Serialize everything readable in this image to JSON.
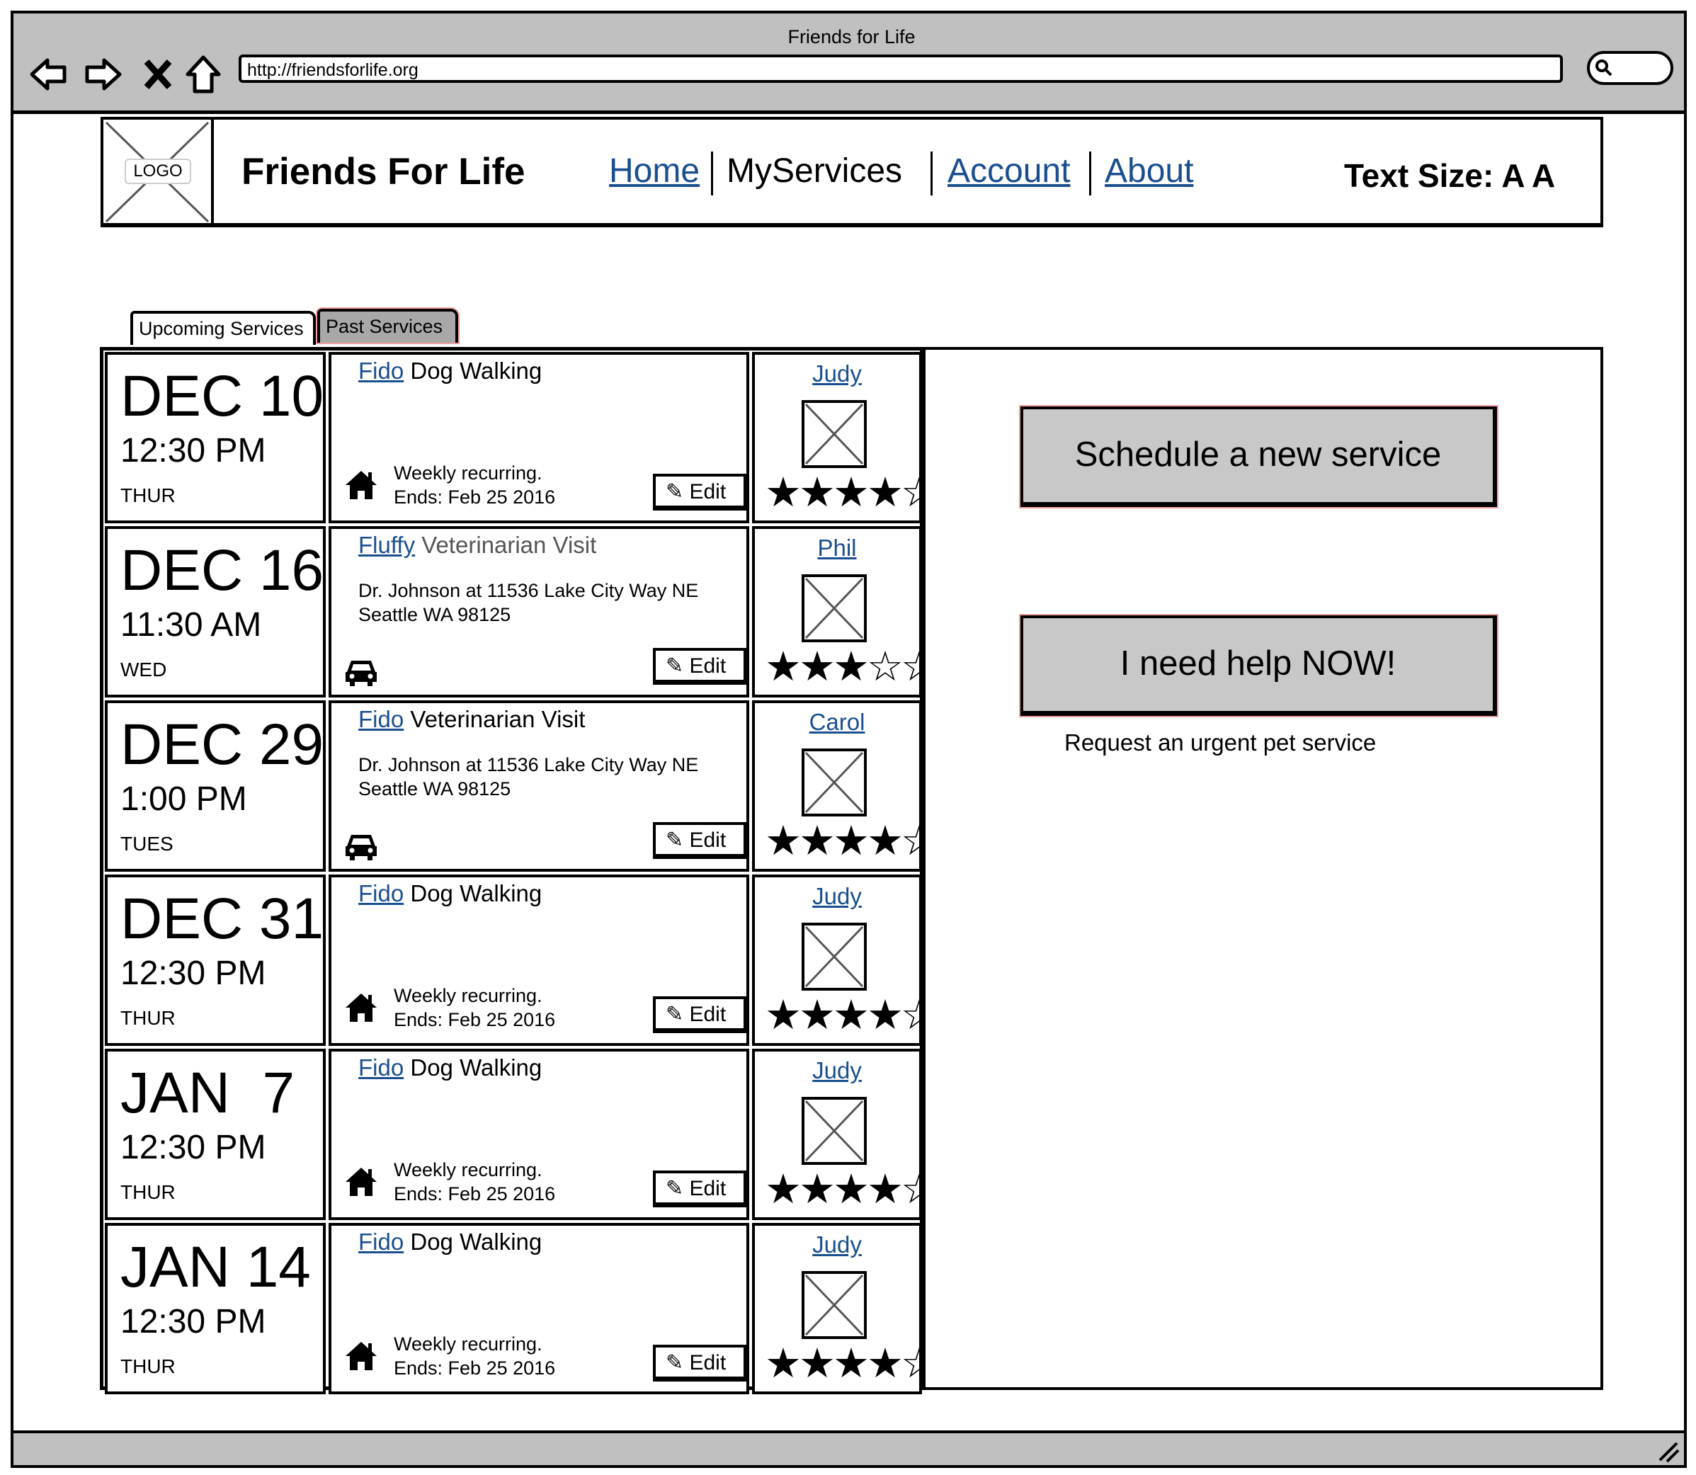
{
  "browser": {
    "window_title": "Friends for Life",
    "url": "http://friendsforlife.org"
  },
  "header": {
    "logo_label": "LOGO",
    "site_title": "Friends For Life",
    "nav": [
      {
        "label": "Home",
        "link": true
      },
      {
        "label": "MyServices",
        "link": false
      },
      {
        "label": "Account",
        "link": true
      },
      {
        "label": "About",
        "link": true
      }
    ],
    "text_size_label": "Text Size: A A"
  },
  "tabs": [
    {
      "label": "Upcoming Services",
      "active": true
    },
    {
      "label": "Past Services",
      "active": false
    }
  ],
  "services": [
    {
      "date": "DEC 10",
      "time": "12:30 PM",
      "day": "THUR",
      "pet": "Fido",
      "service": "Dog Walking",
      "details": [
        "Weekly recurring.",
        "Ends: Feb 25 2016"
      ],
      "icon": "home-icon",
      "edit_label": "Edit",
      "sitter": "Judy",
      "rating": 4
    },
    {
      "date": "DEC 16",
      "time": "11:30 AM",
      "day": "WED",
      "pet": "Fluffy",
      "service": "Veterinarian Visit",
      "details": [
        "Dr. Johnson at 11536 Lake City Way NE",
        "Seattle WA 98125"
      ],
      "icon": "car-icon",
      "edit_label": "Edit",
      "sitter": "Phil",
      "rating": 3
    },
    {
      "date": "DEC 29",
      "time": "1:00 PM",
      "day": "TUES",
      "pet": "Fido",
      "service": "Veterinarian Visit",
      "details": [
        "Dr. Johnson at 11536 Lake City Way NE",
        "Seattle WA 98125"
      ],
      "icon": "car-icon",
      "edit_label": "Edit",
      "sitter": "Carol",
      "rating": 4
    },
    {
      "date": "DEC 31",
      "time": "12:30 PM",
      "day": "THUR",
      "pet": "Fido",
      "service": "Dog Walking",
      "details": [
        "Weekly recurring.",
        "Ends: Feb 25 2016"
      ],
      "icon": "home-icon",
      "edit_label": "Edit",
      "sitter": "Judy",
      "rating": 4
    },
    {
      "date": "JAN  7",
      "time": "12:30 PM",
      "day": "THUR",
      "pet": "Fido",
      "service": "Dog Walking",
      "details": [
        "Weekly recurring.",
        "Ends: Feb 25 2016"
      ],
      "icon": "home-icon",
      "edit_label": "Edit",
      "sitter": "Judy",
      "rating": 4
    },
    {
      "date": "JAN 14",
      "time": "12:30 PM",
      "day": "THUR",
      "pet": "Fido",
      "service": "Dog Walking",
      "details": [
        "Weekly recurring.",
        "Ends: Feb 25 2016"
      ],
      "icon": "home-icon",
      "edit_label": "Edit",
      "sitter": "Judy",
      "rating": 4
    }
  ],
  "rating_max": 5,
  "actions": {
    "schedule_label": "Schedule a new service",
    "help_label": "I need help NOW!",
    "help_caption": "Request an urgent pet service"
  },
  "colors": {
    "link": "#1a4f8f",
    "chrome": "#c0c0c0",
    "button": "#c8c8c8"
  }
}
